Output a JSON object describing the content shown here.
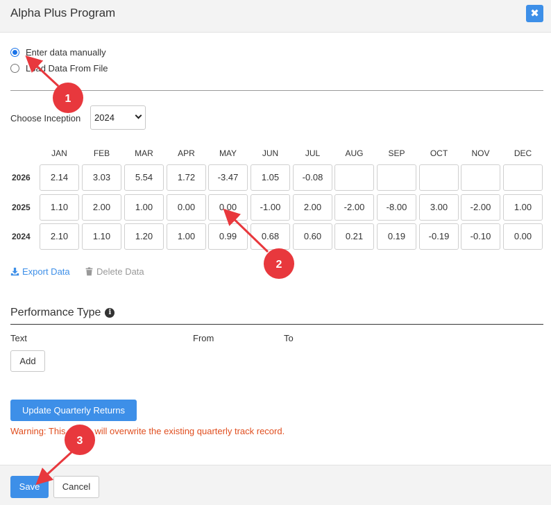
{
  "modal": {
    "title": "Alpha Plus Program",
    "close_glyph": "✖"
  },
  "input_mode": {
    "options": [
      {
        "label": "Enter data manually",
        "checked": true
      },
      {
        "label": "Load Data From File",
        "checked": false
      }
    ]
  },
  "inception": {
    "label": "Choose Inception",
    "selected": "2024"
  },
  "grid": {
    "months": [
      "JAN",
      "FEB",
      "MAR",
      "APR",
      "MAY",
      "JUN",
      "JUL",
      "AUG",
      "SEP",
      "OCT",
      "NOV",
      "DEC"
    ],
    "rows": [
      {
        "year": "2026",
        "values": [
          "2.14",
          "3.03",
          "5.54",
          "1.72",
          "-3.47",
          "1.05",
          "-0.08",
          "",
          "",
          "",
          "",
          ""
        ]
      },
      {
        "year": "2025",
        "values": [
          "1.10",
          "2.00",
          "1.00",
          "0.00",
          "0.00",
          "-1.00",
          "2.00",
          "-2.00",
          "-8.00",
          "3.00",
          "-2.00",
          "1.00"
        ]
      },
      {
        "year": "2024",
        "values": [
          "2.10",
          "1.10",
          "1.20",
          "1.00",
          "0.99",
          "0.68",
          "0.60",
          "0.21",
          "0.19",
          "-0.19",
          "-0.10",
          "0.00"
        ]
      }
    ]
  },
  "actions": {
    "export_label": "Export Data",
    "delete_label": "Delete Data"
  },
  "performance": {
    "title": "Performance Type",
    "info_glyph": "i",
    "columns": [
      "Text",
      "From",
      "To"
    ],
    "add_label": "Add"
  },
  "quarterly": {
    "update_label": "Update Quarterly Returns",
    "warning": "Warning: This action will overwrite the existing quarterly track record."
  },
  "footer": {
    "save_label": "Save",
    "cancel_label": "Cancel"
  },
  "annotations": {
    "markers": [
      "1",
      "2",
      "3"
    ],
    "color": "#e8383d"
  },
  "colors": {
    "primary": "#3d8fe8",
    "warning": "#e04e1f",
    "header_bg": "#f3f3f3"
  }
}
